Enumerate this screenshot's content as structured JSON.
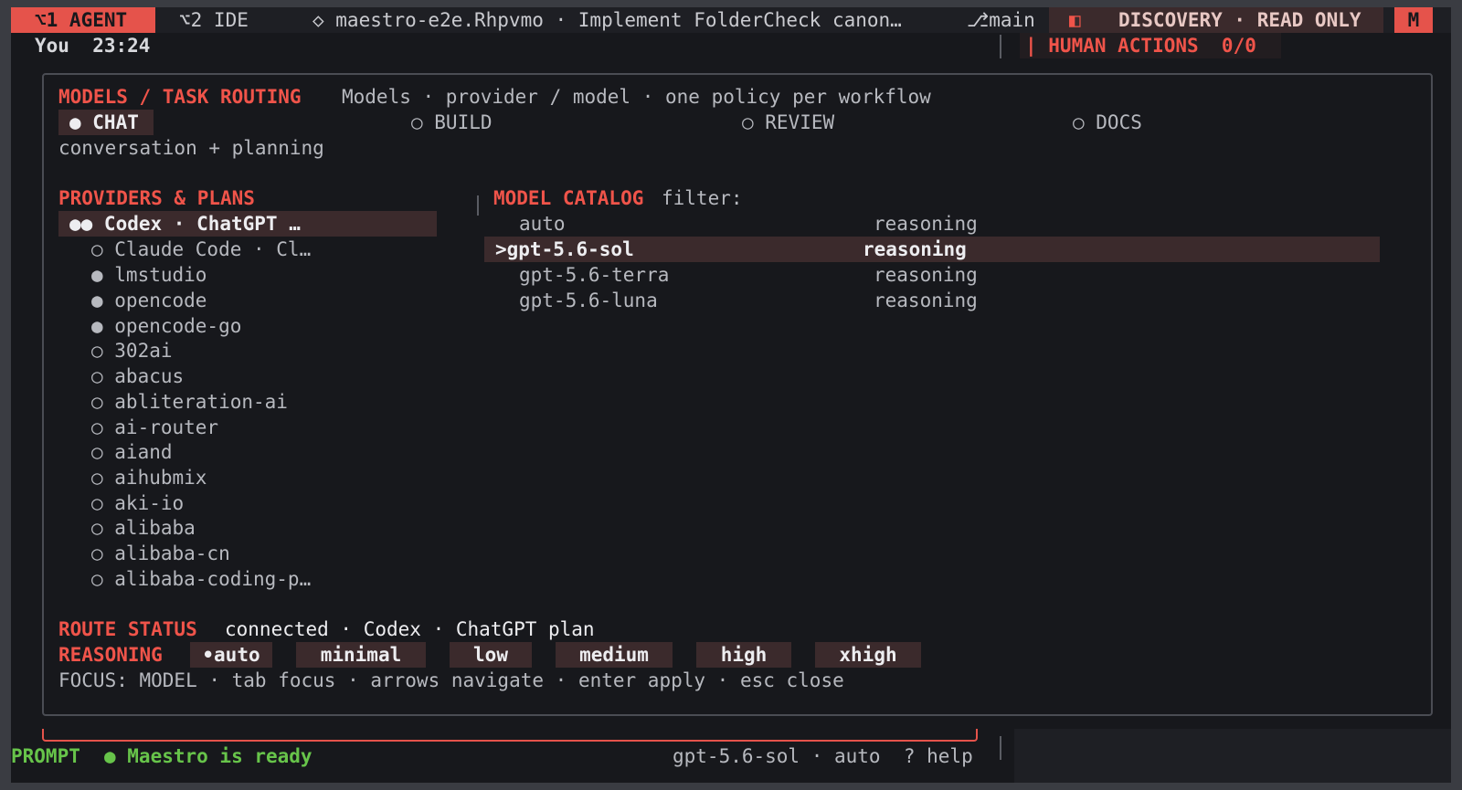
{
  "topbar": {
    "agent_tab": "⌥1 AGENT",
    "ide_tab": "⌥2 IDE",
    "session_title": "◇ maestro-e2e.Rhpvmo · Implement FolderCheck canon…",
    "branch": "⎇main",
    "mode_icon": "◧",
    "mode_badge": "DISCOVERY · READ ONLY",
    "m_badge": "M"
  },
  "header2": {
    "you_label": "You  23:24",
    "human_actions": "| HUMAN ACTIONS  0/0"
  },
  "panel": {
    "title": "MODELS / TASK ROUTING",
    "subtitle": "Models · provider / model · one policy per workflow",
    "workflows": [
      {
        "label": "● CHAT",
        "selected": true
      },
      {
        "label": "○ BUILD",
        "selected": false
      },
      {
        "label": "○ REVIEW",
        "selected": false
      },
      {
        "label": "○ DOCS",
        "selected": false
      }
    ],
    "workflow_description": "conversation + planning",
    "providers_heading": "PROVIDERS & PLANS",
    "providers": [
      {
        "label": "●● Codex · ChatGPT …",
        "selected": true
      },
      {
        "label": "○ Claude Code · Cl…"
      },
      {
        "label": "● lmstudio"
      },
      {
        "label": "● opencode"
      },
      {
        "label": "● opencode-go"
      },
      {
        "label": "○ 302ai"
      },
      {
        "label": "○ abacus"
      },
      {
        "label": "○ abliteration-ai"
      },
      {
        "label": "○ ai-router"
      },
      {
        "label": "○ aiand"
      },
      {
        "label": "○ aihubmix"
      },
      {
        "label": "○ aki-io"
      },
      {
        "label": "○ alibaba"
      },
      {
        "label": "○ alibaba-cn"
      },
      {
        "label": "○ alibaba-coding-p…"
      }
    ],
    "catalog_heading": "MODEL CATALOG",
    "catalog_filter": "filter:",
    "models": [
      {
        "name": "auto",
        "kind": "reasoning",
        "selected": false
      },
      {
        "name": ">gpt-5.6-sol",
        "kind": "reasoning",
        "selected": true
      },
      {
        "name": "gpt-5.6-terra",
        "kind": "reasoning",
        "selected": false
      },
      {
        "name": "gpt-5.6-luna",
        "kind": "reasoning",
        "selected": false
      }
    ],
    "route_status_label": "ROUTE STATUS",
    "route_status_value": "connected · Codex · ChatGPT plan",
    "reasoning_label": "REASONING",
    "reasoning_options": [
      "•auto",
      "minimal",
      "low",
      "medium",
      "high",
      "xhigh"
    ],
    "focus_hint": "FOCUS: MODEL · tab focus · arrows navigate · enter apply · esc close"
  },
  "statusbar": {
    "prompt_label": "PROMPT",
    "ready": "● Maestro is ready",
    "right": "gpt-5.6-sol · auto  ? help"
  },
  "colors": {
    "accent": "#e5534b",
    "background": "#17181c",
    "selection": "#3b2a2c",
    "green": "#67c44a"
  }
}
